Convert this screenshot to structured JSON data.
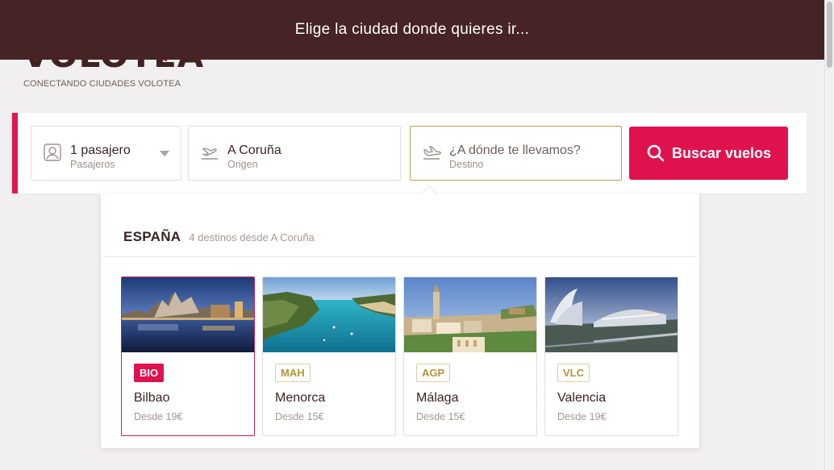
{
  "banner": {
    "text": "Elige la ciudad donde quieres ir..."
  },
  "brand": {
    "name": "VOLOTEA",
    "tagline": "CONECTANDO CIUDADES VOLOTEA"
  },
  "search": {
    "passengers": {
      "value": "1 pasajero",
      "label": "Pasajeros",
      "icon": "person-icon"
    },
    "origin": {
      "value": "A Coruña",
      "label": "Origen",
      "icon": "plane-takeoff-icon"
    },
    "destination": {
      "value": "¿A dónde te llevamos?",
      "label": "Destino",
      "icon": "plane-landing-icon"
    },
    "button": {
      "label": "Buscar vuelos",
      "icon": "search-icon"
    }
  },
  "dropdown": {
    "country": "ESPAÑA",
    "count_text": "4 destinos desde A Coruña",
    "destinations": [
      {
        "code": "BIO",
        "city": "Bilbao",
        "price": "Desde 19€",
        "selected": true
      },
      {
        "code": "MAH",
        "city": "Menorca",
        "price": "Desde 15€",
        "selected": false
      },
      {
        "code": "AGP",
        "city": "Málaga",
        "price": "Desde 15€",
        "selected": false
      },
      {
        "code": "VLC",
        "city": "Valencia",
        "price": "Desde 19€",
        "selected": false
      }
    ]
  },
  "colors": {
    "brand_red": "#e0124e",
    "banner_bg": "#462325",
    "text_dark": "#3b2323",
    "badge_gold": "#b2943a"
  }
}
